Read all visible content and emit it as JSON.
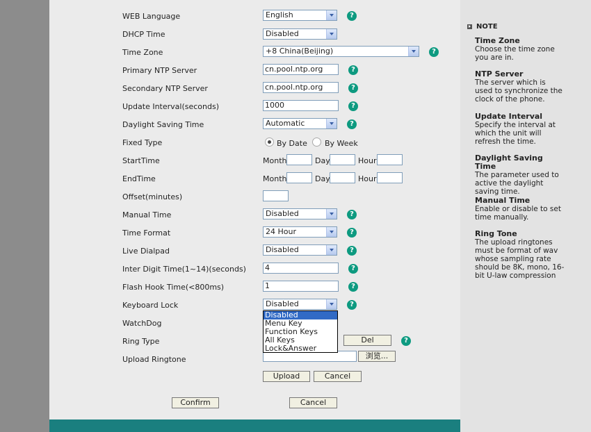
{
  "form": {
    "web_language": {
      "label": "WEB Language",
      "value": "English"
    },
    "dhcp_time": {
      "label": "DHCP Time",
      "value": "Disabled"
    },
    "time_zone": {
      "label": "Time Zone",
      "value": "+8 China(Beijing)"
    },
    "primary_ntp": {
      "label": "Primary NTP Server",
      "value": "cn.pool.ntp.org"
    },
    "secondary_ntp": {
      "label": "Secondary NTP Server",
      "value": "cn.pool.ntp.org"
    },
    "update_interval": {
      "label": "Update Interval(seconds)",
      "value": "1000"
    },
    "daylight_saving": {
      "label": "Daylight Saving Time",
      "value": "Automatic"
    },
    "fixed_type": {
      "label": "Fixed Type",
      "by_date": "By Date",
      "by_week": "By Week",
      "selected": "By Date"
    },
    "start_time": {
      "label": "StartTime",
      "month": "Month",
      "day": "Day",
      "hour": "Hour"
    },
    "end_time": {
      "label": "EndTime",
      "month": "Month",
      "day": "Day",
      "hour": "Hour"
    },
    "offset": {
      "label": "Offset(minutes)",
      "value": ""
    },
    "manual_time": {
      "label": "Manual Time",
      "value": "Disabled"
    },
    "time_format": {
      "label": "Time Format",
      "value": "24 Hour"
    },
    "live_dialpad": {
      "label": "Live Dialpad",
      "value": "Disabled"
    },
    "inter_digit": {
      "label": "Inter Digit Time(1~14)(seconds)",
      "value": "4"
    },
    "flash_hook": {
      "label": "Flash Hook Time(<800ms)",
      "value": "1"
    },
    "keyboard_lock": {
      "label": "Keyboard Lock",
      "value": "Disabled",
      "options": [
        "Disabled",
        "Menu Key",
        "Function Keys",
        "All Keys",
        "Lock&Answer"
      ]
    },
    "watchdog": {
      "label": "WatchDog"
    },
    "ring_type": {
      "label": "Ring Type",
      "del_label": "Del"
    },
    "upload_ringtone": {
      "label": "Upload Ringtone",
      "browse_label": "浏览...",
      "upload_label": "Upload",
      "cancel_label": "Cancel"
    },
    "confirm_label": "Confirm",
    "cancel_label": "Cancel",
    "help_glyph": "?"
  },
  "sidebar": {
    "title": "NOTE",
    "notes": [
      {
        "heading": "Time Zone",
        "text": "Choose the time zone you are in."
      },
      {
        "heading": "NTP Server",
        "text": "The server which is used to synchronize the clock of the phone."
      },
      {
        "heading": "Update Interval",
        "text": "Specify the interval at which the unit will refresh the time."
      },
      {
        "heading": "Daylight Saving Time",
        "text": "The parameter used to active the daylight saving time."
      },
      {
        "heading": "Manual Time",
        "text": "Enable or disable to set time manually."
      },
      {
        "heading": "Ring Tone",
        "text": "The upload ringtones must be format of wav whose sampling rate should be 8K, mono, 16-bit U-law compression"
      }
    ]
  },
  "colors": {
    "accent": "#1a7f7f",
    "help": "#0d9a80",
    "selection": "#316ac5"
  }
}
